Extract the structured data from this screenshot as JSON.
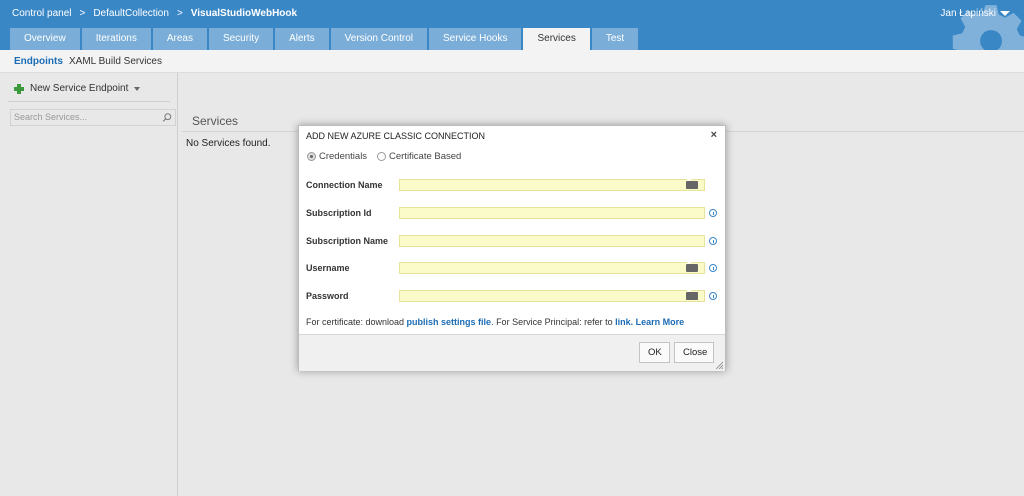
{
  "header": {
    "breadcrumb": [
      "Control panel",
      "DefaultCollection",
      "VisualStudioWebHook"
    ],
    "breadcrumb_sep": ">",
    "user": "Jan Łapiński",
    "tabs": [
      "Overview",
      "Iterations",
      "Areas",
      "Security",
      "Alerts",
      "Version Control",
      "Service Hooks",
      "Services",
      "Test"
    ],
    "active_tab": "Services"
  },
  "subnav": {
    "items": [
      "Endpoints",
      "XAML Build Services"
    ],
    "active": "Endpoints"
  },
  "left": {
    "new_button": "New Service Endpoint",
    "search_placeholder": "Search Services..."
  },
  "main": {
    "title": "Services",
    "empty_text": "No Services found."
  },
  "dialog": {
    "title": "ADD NEW AZURE CLASSIC CONNECTION",
    "close": "×",
    "radios": [
      "Credentials",
      "Certificate Based"
    ],
    "selected_radio": "Credentials",
    "fields": [
      "Connection Name",
      "Subscription Id",
      "Subscription Name",
      "Username",
      "Password"
    ],
    "note_prefix": "For certificate: download ",
    "note_link1": "publish settings file",
    "note_middle": ". For Service Principal: refer to ",
    "note_link2": "link.",
    "note_link3": "Learn More",
    "ok": "OK",
    "close_button": "Close"
  },
  "colors": {
    "header_bg": "#3a87c6",
    "tab_bg": "#7aaed8",
    "input_bg": "#fafbc8",
    "link": "#1b6cb5"
  }
}
